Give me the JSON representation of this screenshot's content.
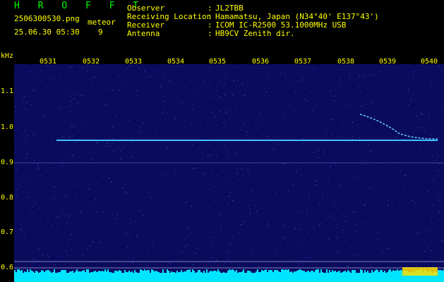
{
  "header": {
    "title": "H R O F F T",
    "filename": "2506300530.png",
    "meteor_label": "meteor",
    "datetime": "25.06.30 05:30",
    "meteor_count": "9"
  },
  "station": {
    "rows": [
      {
        "label": "Observer",
        "value": "JL2TBB"
      },
      {
        "label": "Receiving Location",
        "value": "Hamamatsu, Japan (N34°40' E137°43')"
      },
      {
        "label": "Receiver",
        "value": "ICOM IC-R2500 53.1000MHz USB"
      },
      {
        "label": "Antenna",
        "value": "HB9CV Zenith dir."
      }
    ]
  },
  "axes": {
    "y_unit": "kHz",
    "y_ticks": [
      "1.1",
      "1.0",
      "0.9",
      "0.8",
      "0.7",
      "0.6"
    ],
    "x_ticks": [
      "0531",
      "0532",
      "0533",
      "0534",
      "0535",
      "0536",
      "0537",
      "0538",
      "0539",
      "0540"
    ]
  },
  "colors": {
    "background": "#000000",
    "plot_bg": "#0b0b5e",
    "text": "#ffff00",
    "title": "#00ff00",
    "trace": "#40c0ff",
    "noise_floor": "#00e5ff"
  }
}
